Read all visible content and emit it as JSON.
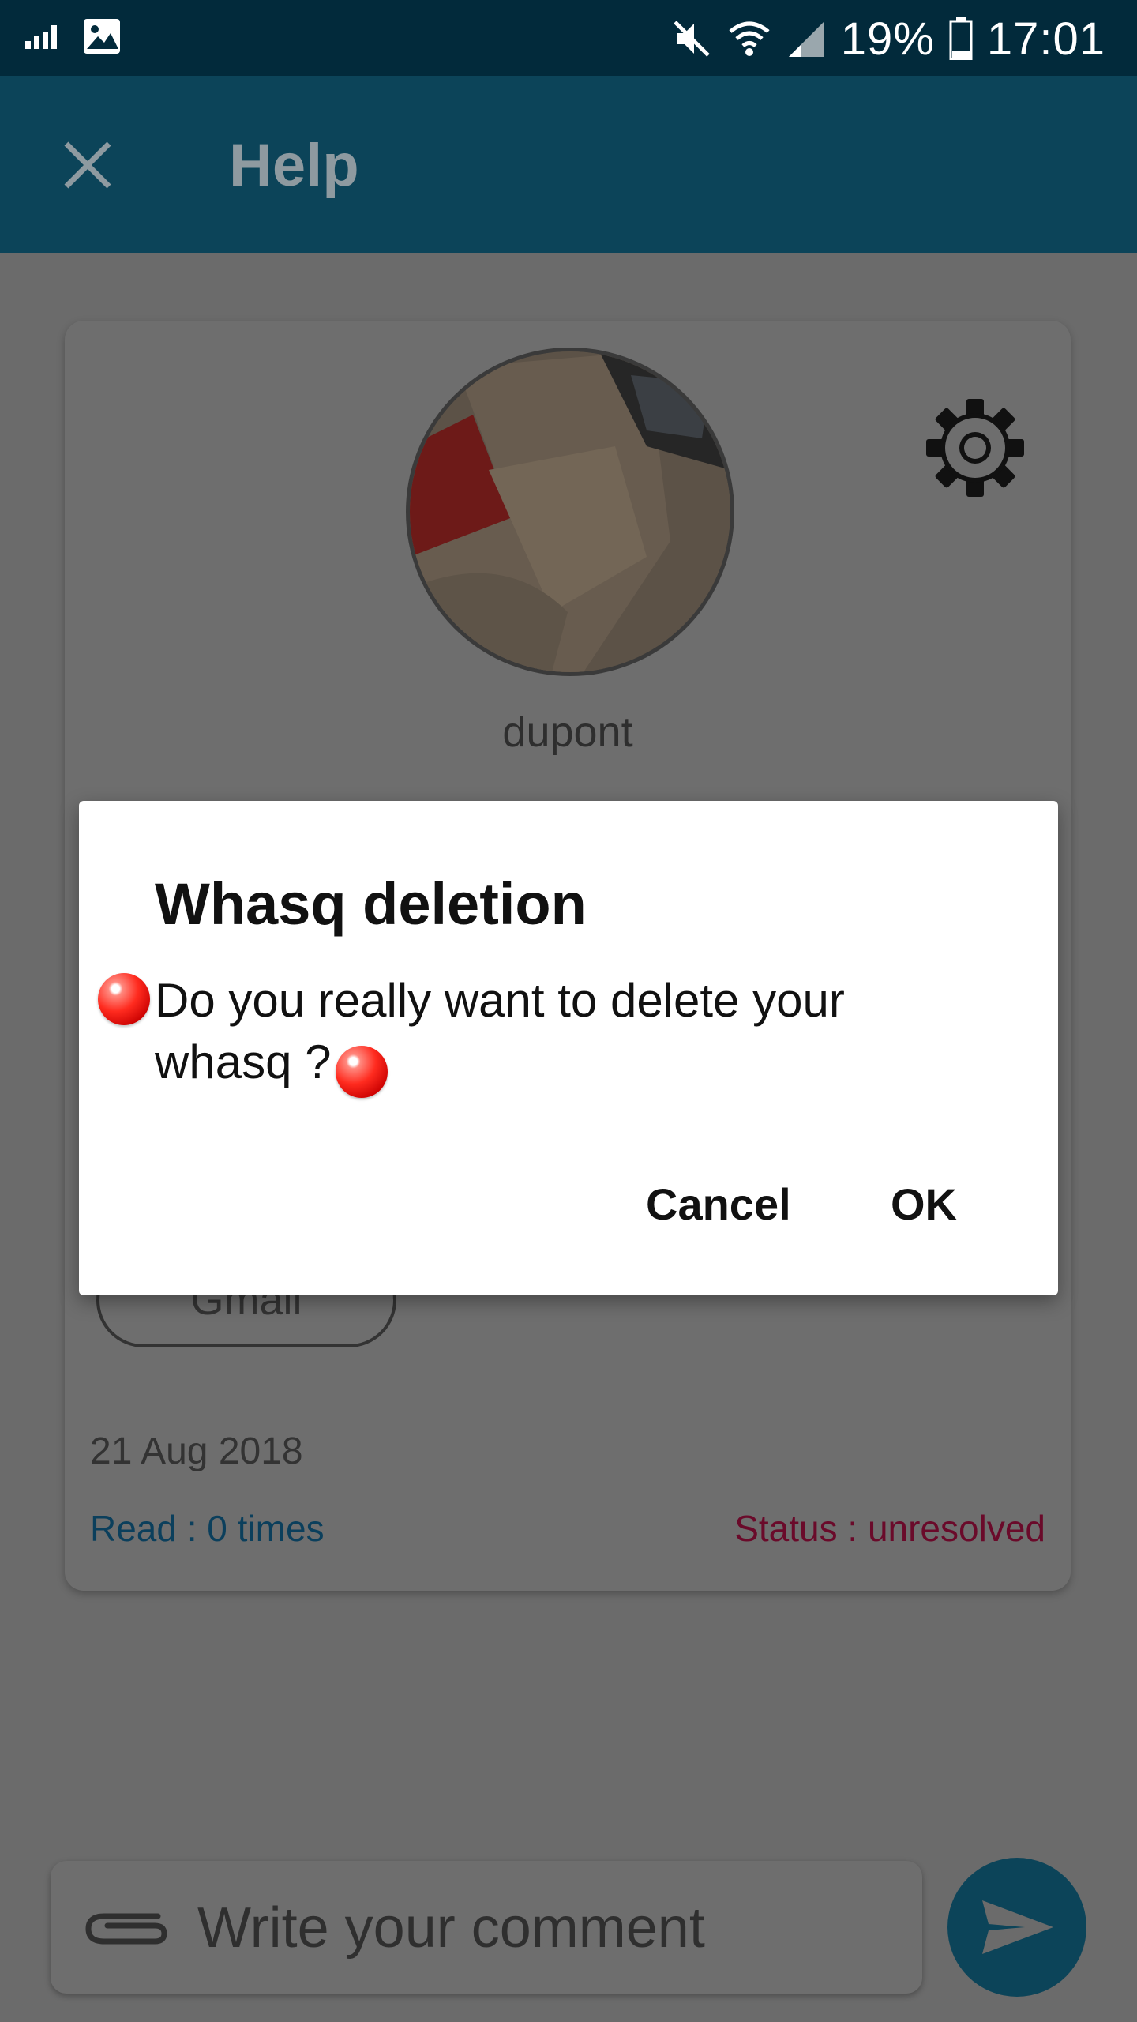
{
  "status_bar": {
    "battery": "19%",
    "time": "17:01"
  },
  "app_bar": {
    "title": "Help"
  },
  "card": {
    "username": "dupont",
    "tag": "Gmail",
    "date": "21 Aug 2018",
    "read": "Read : 0 times",
    "status": "Status : unresolved"
  },
  "comment": {
    "placeholder": "Write your comment"
  },
  "dialog": {
    "title": "Whasq deletion",
    "message": "Do you really want to delete your whasq ?",
    "cancel_label": "Cancel",
    "ok_label": "OK"
  },
  "colors": {
    "status_bar": "#022a3b",
    "app_bar": "#0c4459",
    "overlay": "#6b6b6b",
    "read_link": "#0b3f5c",
    "status_text": "#6a0a2a"
  },
  "icons": [
    "signal-icon",
    "image-icon",
    "mute-icon",
    "wifi-icon",
    "cell-signal-icon",
    "battery-icon",
    "close-icon",
    "gear-icon",
    "paperclip-icon",
    "send-icon"
  ]
}
